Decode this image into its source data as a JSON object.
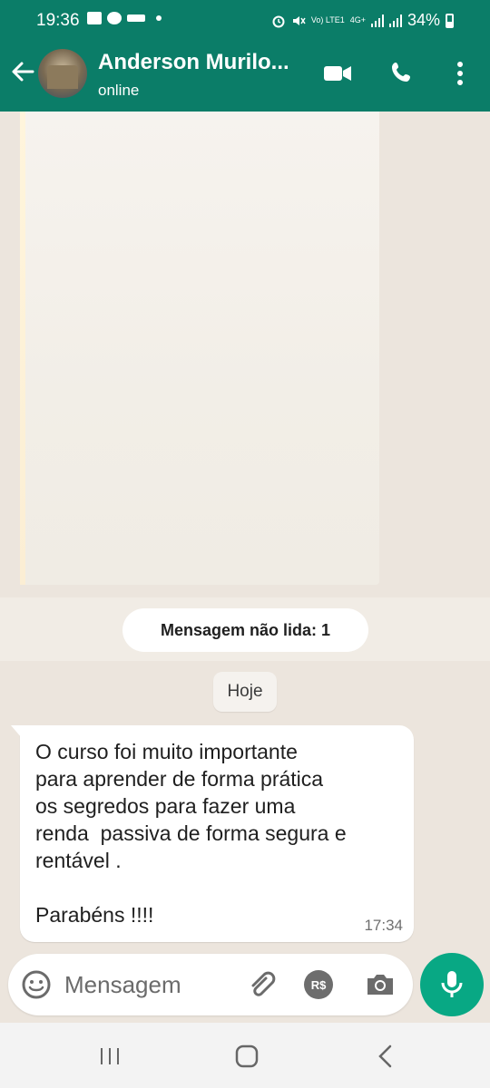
{
  "status_bar": {
    "time": "19:36",
    "carrier_label": "Vo) LTE1",
    "network": "4G+",
    "battery": "34%"
  },
  "header": {
    "contact_name": "Anderson Murilo...",
    "presence": "online"
  },
  "chat": {
    "unread_label": "Mensagem não lida: 1",
    "day_label": "Hoje",
    "messages": [
      {
        "text": "O curso foi muito importante\npara aprender de forma prática\nos segredos para fazer uma\nrenda  passiva de forma segura e\nrentável .\n\nParabéns !!!!",
        "time": "17:34"
      }
    ]
  },
  "composer": {
    "placeholder": "Mensagem",
    "payment_label": "R$"
  },
  "colors": {
    "header_bg": "#0b7d68",
    "chat_bg": "#ece5dd",
    "mic_bg": "#08a884"
  }
}
